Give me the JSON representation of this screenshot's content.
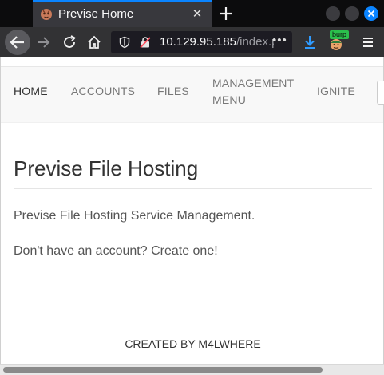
{
  "browser": {
    "tab": {
      "title": "Previse Home",
      "close_glyph": "✕"
    },
    "url": {
      "main": "10.129.95.185",
      "rest": "/index.php"
    },
    "page_actions_glyph": "•••",
    "extension_badge": "burp",
    "accent_color": "#0a84ff"
  },
  "site": {
    "nav": [
      {
        "label": "HOME",
        "active": true
      },
      {
        "label": "ACCOUNTS",
        "active": false
      },
      {
        "label": "FILES",
        "active": false
      },
      {
        "label": "MANAGEMENT",
        "label2": "MENU",
        "active": false
      },
      {
        "label": "IGNITE",
        "active": false
      }
    ],
    "title": "Previse File Hosting",
    "description": "Previse File Hosting Service Management.",
    "account_prompt": "Don't have an account? Create one!",
    "footer": "CREATED BY M4LWHERE"
  }
}
